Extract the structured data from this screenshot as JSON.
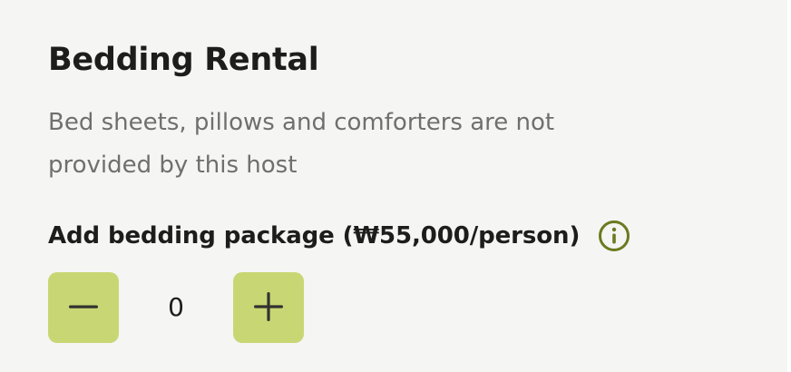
{
  "section": {
    "title": "Bedding Rental",
    "description_line1": "Bed sheets, pillows and comforters are not",
    "description_line2": "provided by this host"
  },
  "package": {
    "label": "Add bedding package (₩55,000/person)",
    "info_icon": "info-icon"
  },
  "stepper": {
    "decrement_icon": "minus-icon",
    "increment_icon": "plus-icon",
    "quantity": "0"
  },
  "colors": {
    "background": "#f5f5f4",
    "button": "#c8d774",
    "accent": "#6b7a1f",
    "title": "#1d1d1b",
    "muted_text": "#6f6f6d"
  }
}
